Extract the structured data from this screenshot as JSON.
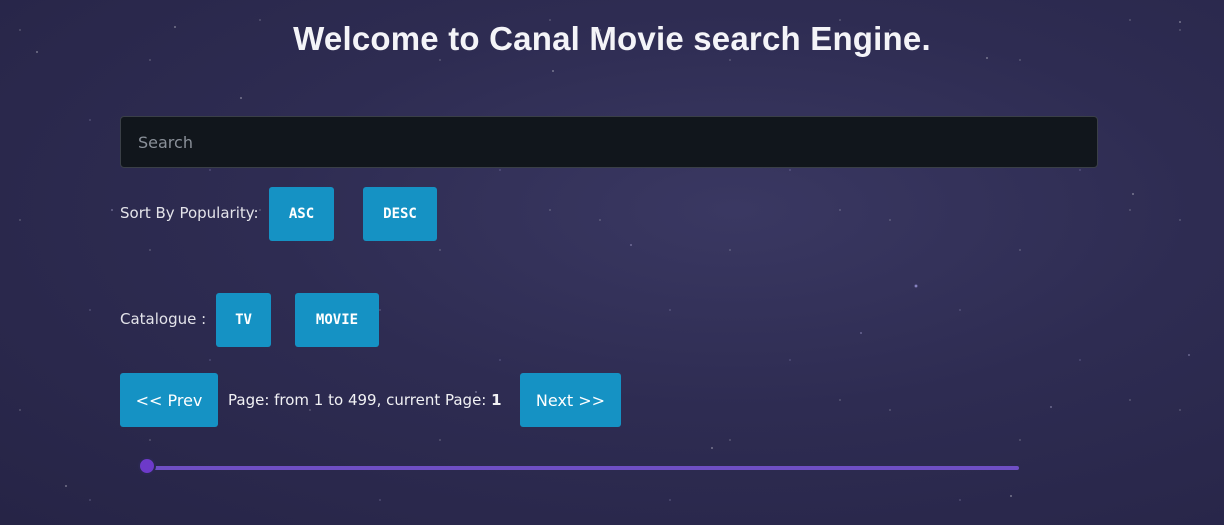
{
  "header": {
    "title": "Welcome to Canal Movie search Engine."
  },
  "search": {
    "placeholder": "Search",
    "value": ""
  },
  "sort": {
    "label": "Sort By Popularity:",
    "asc_label": "ASC",
    "desc_label": "DESC"
  },
  "catalogue": {
    "label": "Catalogue :",
    "tv_label": "TV",
    "movie_label": "MOVIE"
  },
  "pagination": {
    "prev_label": "<< Prev",
    "next_label": "Next >>",
    "info_text": "Page: from 1 to 499, current Page:",
    "current_page": "1",
    "min_page": 1,
    "max_page": 499
  },
  "colors": {
    "button": "#1592c4",
    "slider": "#6f4fc4",
    "search_bg": "#11161c"
  }
}
